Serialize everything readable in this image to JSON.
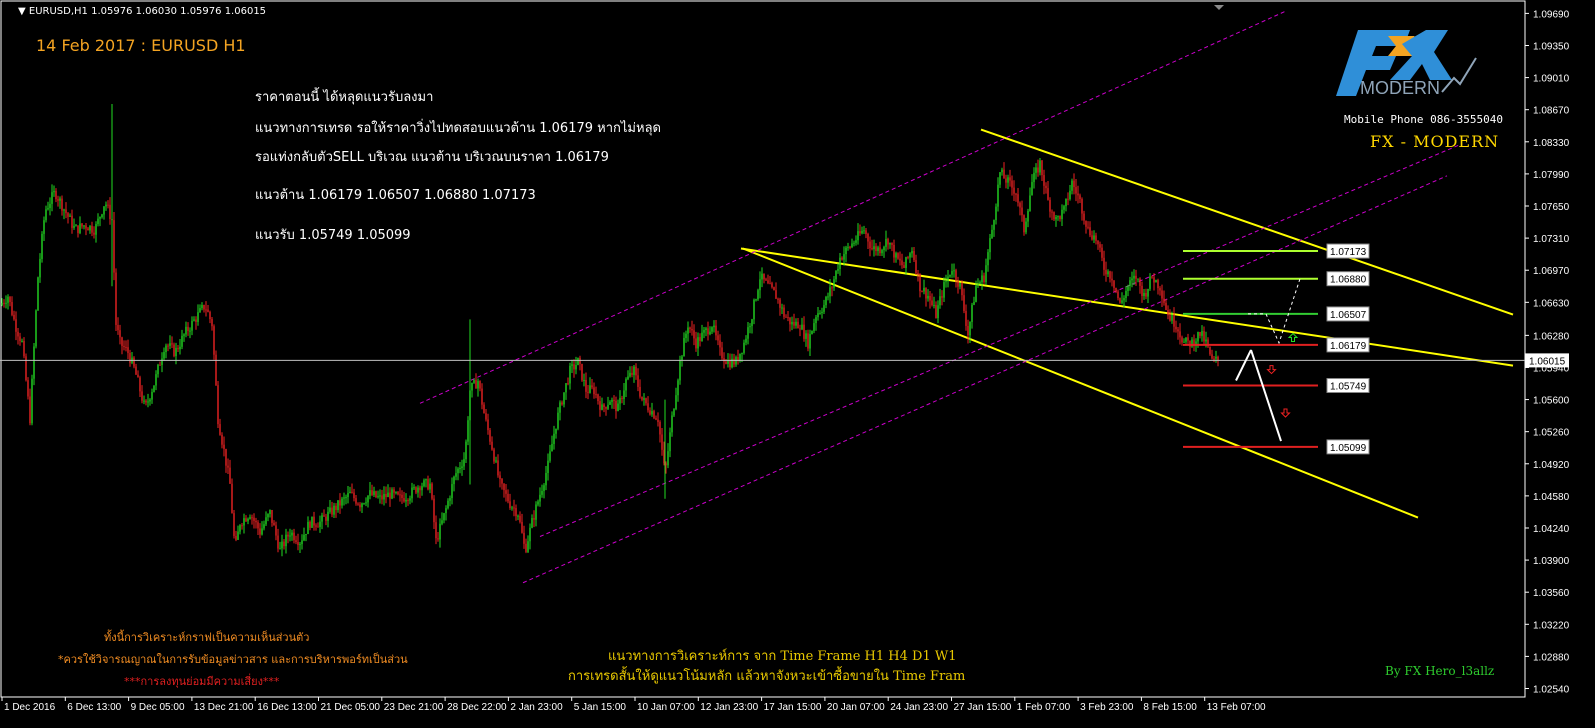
{
  "header": {
    "symbol_label": "EURUSD,H1",
    "ohlc": "1.05976 1.06030 1.05976 1.06015"
  },
  "title": "14 Feb 2017 : EURUSD H1",
  "analysis_lines": [
    "ราคาตอนนี้ ได้หลุดแนวรับลงมา",
    " แนวทางการเทรด รอให้ราคาวิ่งไปทดสอบแนวต้าน 1.06179 หากไม่หลุด",
    "รอแท่งกลับตัวSELL บริเวณ แนวต้าน บริเวณบนราคา 1.06179",
    "แนวต้าน  1.06179  1.06507  1.06880   1.07173",
    "แนวรับ  1.05749  1.05099"
  ],
  "logo": {
    "fx_text": "FX",
    "modern_text": "MODERN",
    "colors": {
      "primary": "#2f8fd8",
      "accent": "#f4a422"
    }
  },
  "contact": "Mobile Phone 086-3555040",
  "brand": "FX  -  MODERN",
  "credit": "By FX Hero_l3allz",
  "disclaimer": [
    "ทั้งนี้การวิเคราะห์กราฟเป็นความเห็นส่วนตัว",
    "*ควรใช้วิจารณญาณในการรับข้อมูลข่าวสาร และการบริหารพอร์ทเป็นส่วน",
    "***การลงทุนย่อมมีความเสี่ยง***"
  ],
  "note": [
    "แนวทางการวิเคราะห์การ จาก Time Frame H1 H4 D1 W1",
    "การเทรดสั้นให้ดูแนวโน้มหลัก แล้วหาจังหวะเข้าซื้อขายใน Time Fram"
  ],
  "chart_data": {
    "type": "candlestick",
    "timeframe": "H1",
    "symbol": "EURUSD",
    "ylim": [
      1.0245,
      1.098
    ],
    "y_ticks": [
      "1.09690",
      "1.09350",
      "1.09010",
      "1.08670",
      "1.08330",
      "1.07990",
      "1.07650",
      "1.07310",
      "1.06970",
      "1.06630",
      "1.06280",
      "1.05940",
      "1.05600",
      "1.05260",
      "1.04920",
      "1.04580",
      "1.04240",
      "1.03900",
      "1.03560",
      "1.03220",
      "1.02880",
      "1.02540"
    ],
    "x_ticks": [
      "1 Dec 2016",
      "6 Dec 13:00",
      "9 Dec 05:00",
      "13 Dec 21:00",
      "16 Dec 13:00",
      "21 Dec 05:00",
      "23 Dec 21:00",
      "28 Dec 22:00",
      "2 Jan 23:00",
      "5 Jan 15:00",
      "10 Jan 07:00",
      "12 Jan 23:00",
      "17 Jan 15:00",
      "20 Jan 07:00",
      "24 Jan 23:00",
      "27 Jan 15:00",
      "1 Feb 07:00",
      "3 Feb 23:00",
      "8 Feb 15:00",
      "13 Feb 07:00"
    ],
    "current_price": "1.06015",
    "current_price_label": "1.06015",
    "close_path": [
      [
        0,
        1.066
      ],
      [
        8,
        1.067
      ],
      [
        15,
        1.064
      ],
      [
        22,
        1.062
      ],
      [
        30,
        1.054
      ],
      [
        38,
        1.069
      ],
      [
        45,
        1.076
      ],
      [
        55,
        1.078
      ],
      [
        65,
        1.076
      ],
      [
        75,
        1.074
      ],
      [
        85,
        1.0745
      ],
      [
        95,
        1.074
      ],
      [
        105,
        1.077
      ],
      [
        112,
        1.075
      ],
      [
        116,
        1.064
      ],
      [
        120,
        1.062
      ],
      [
        128,
        1.061
      ],
      [
        135,
        1.059
      ],
      [
        145,
        1.055
      ],
      [
        155,
        1.058
      ],
      [
        165,
        1.062
      ],
      [
        175,
        1.061
      ],
      [
        185,
        1.063
      ],
      [
        195,
        1.0645
      ],
      [
        205,
        1.066
      ],
      [
        212,
        1.064
      ],
      [
        218,
        1.054
      ],
      [
        225,
        1.05
      ],
      [
        230,
        1.047
      ],
      [
        235,
        1.04
      ],
      [
        240,
        1.043
      ],
      [
        250,
        1.044
      ],
      [
        260,
        1.042
      ],
      [
        270,
        1.044
      ],
      [
        280,
        1.04
      ],
      [
        290,
        1.042
      ],
      [
        300,
        1.041
      ],
      [
        310,
        1.043
      ],
      [
        320,
        1.043
      ],
      [
        330,
        1.044
      ],
      [
        340,
        1.045
      ],
      [
        350,
        1.046
      ],
      [
        360,
        1.045
      ],
      [
        370,
        1.046
      ],
      [
        380,
        1.0455
      ],
      [
        390,
        1.046
      ],
      [
        400,
        1.0455
      ],
      [
        410,
        1.046
      ],
      [
        420,
        1.047
      ],
      [
        430,
        1.047
      ],
      [
        436,
        1.041
      ],
      [
        445,
        1.044
      ],
      [
        455,
        1.048
      ],
      [
        465,
        1.05
      ],
      [
        470,
        1.057
      ],
      [
        478,
        1.058
      ],
      [
        485,
        1.054
      ],
      [
        492,
        1.051
      ],
      [
        500,
        1.047
      ],
      [
        510,
        1.045
      ],
      [
        518,
        1.044
      ],
      [
        525,
        1.04
      ],
      [
        532,
        1.043
      ],
      [
        540,
        1.046
      ],
      [
        548,
        1.049
      ],
      [
        555,
        1.053
      ],
      [
        562,
        1.056
      ],
      [
        570,
        1.059
      ],
      [
        578,
        1.06
      ],
      [
        586,
        1.057
      ],
      [
        594,
        1.057
      ],
      [
        602,
        1.055
      ],
      [
        610,
        1.056
      ],
      [
        618,
        1.055
      ],
      [
        626,
        1.058
      ],
      [
        634,
        1.059
      ],
      [
        642,
        1.056
      ],
      [
        650,
        1.055
      ],
      [
        658,
        1.054
      ],
      [
        665,
        1.048
      ],
      [
        672,
        1.054
      ],
      [
        680,
        1.06
      ],
      [
        688,
        1.064
      ],
      [
        696,
        1.062
      ],
      [
        704,
        1.063
      ],
      [
        712,
        1.064
      ],
      [
        720,
        1.061
      ],
      [
        728,
        1.06
      ],
      [
        736,
        1.06
      ],
      [
        744,
        1.062
      ],
      [
        752,
        1.065
      ],
      [
        760,
        1.069
      ],
      [
        768,
        1.068
      ],
      [
        776,
        1.067
      ],
      [
        784,
        1.065
      ],
      [
        792,
        1.064
      ],
      [
        800,
        1.064
      ],
      [
        808,
        1.062
      ],
      [
        816,
        1.065
      ],
      [
        824,
        1.066
      ],
      [
        832,
        1.068
      ],
      [
        840,
        1.071
      ],
      [
        848,
        1.072
      ],
      [
        856,
        1.073
      ],
      [
        864,
        1.074
      ],
      [
        872,
        1.072
      ],
      [
        880,
        1.072
      ],
      [
        888,
        1.073
      ],
      [
        896,
        1.071
      ],
      [
        904,
        1.07
      ],
      [
        912,
        1.072
      ],
      [
        920,
        1.068
      ],
      [
        928,
        1.067
      ],
      [
        936,
        1.065
      ],
      [
        944,
        1.068
      ],
      [
        952,
        1.07
      ],
      [
        960,
        1.068
      ],
      [
        968,
        1.063
      ],
      [
        976,
        1.068
      ],
      [
        984,
        1.069
      ],
      [
        992,
        1.074
      ],
      [
        1000,
        1.08
      ],
      [
        1008,
        1.079
      ],
      [
        1016,
        1.078
      ],
      [
        1024,
        1.074
      ],
      [
        1032,
        1.079
      ],
      [
        1040,
        1.081
      ],
      [
        1048,
        1.077
      ],
      [
        1056,
        1.075
      ],
      [
        1064,
        1.076
      ],
      [
        1072,
        1.079
      ],
      [
        1080,
        1.077
      ],
      [
        1088,
        1.074
      ],
      [
        1096,
        1.073
      ],
      [
        1104,
        1.07
      ],
      [
        1112,
        1.069
      ],
      [
        1120,
        1.066
      ],
      [
        1128,
        1.068
      ],
      [
        1136,
        1.069
      ],
      [
        1144,
        1.067
      ],
      [
        1152,
        1.069
      ],
      [
        1160,
        1.068
      ],
      [
        1168,
        1.065
      ],
      [
        1176,
        1.064
      ],
      [
        1184,
        1.062
      ],
      [
        1192,
        1.062
      ],
      [
        1200,
        1.063
      ],
      [
        1206,
        1.062
      ],
      [
        1212,
        1.06
      ],
      [
        1218,
        1.0602
      ]
    ],
    "channels": [
      {
        "name": "",
        "color": "#ffff00",
        "style": "solid",
        "lines": [
          [
            [
              741,
              1.072
            ],
            [
              1513,
              1.0596
            ]
          ],
          [
            [
              743,
              1.072
            ],
            [
              1418,
              1.0435
            ]
          ]
        ]
      },
      {
        "name": "",
        "color": "#ffff00",
        "style": "solid",
        "lines": [
          [
            [
              981,
              1.0846
            ],
            [
              1513,
              1.065
            ]
          ]
        ]
      },
      {
        "name": "",
        "color": "#cc00cc",
        "style": "dashed",
        "lines": [
          [
            [
              420,
              1.0556
            ],
            [
              1287,
              1.0972
            ]
          ],
          [
            [
              523,
              1.0366
            ],
            [
              1447,
              1.0797
            ]
          ],
          [
            [
              540,
              1.0415
            ],
            [
              1460,
              1.083
            ]
          ]
        ]
      }
    ],
    "levels": [
      {
        "value": "1.07173",
        "color": "#adff2f",
        "x_start": 1183
      },
      {
        "value": "1.06880",
        "color": "#adff2f",
        "x_start": 1183
      },
      {
        "value": "1.06507",
        "color": "#32cd32",
        "x_start": 1183
      },
      {
        "value": "1.06179",
        "color": "#e02020",
        "x_start": 1183
      },
      {
        "value": "1.05749",
        "color": "#e02020",
        "x_start": 1183
      },
      {
        "value": "1.05099",
        "color": "#e02020",
        "x_start": 1183
      }
    ]
  }
}
